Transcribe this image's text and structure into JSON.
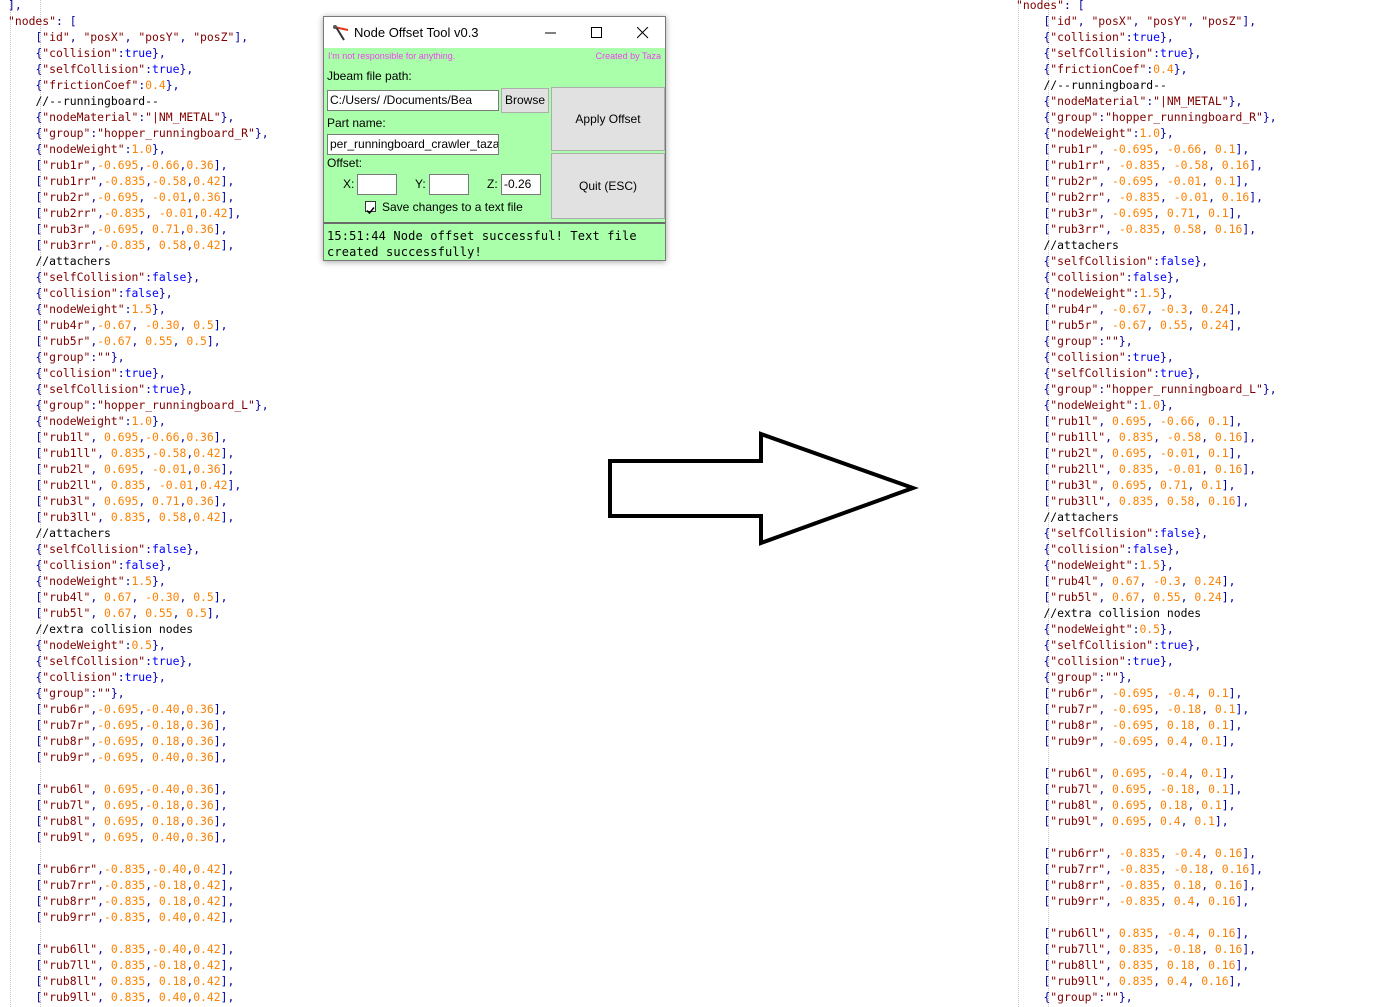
{
  "tool_window": {
    "title": "Node Offset Tool v0.3",
    "disclaimer": "I'm not responsible for anything.",
    "credit": "Created by Taza",
    "jbeam_path_label": "Jbeam file path:",
    "jbeam_path_value": "C:/Users/        /Documents/Bea",
    "browse_label": "Browse",
    "part_name_label": "Part name:",
    "part_name_value": "per_runningboard_crawler_taza",
    "offset_label": "Offset:",
    "x_label": "X:",
    "x_value": "",
    "y_label": "Y:",
    "y_value": "",
    "z_label": "Z:",
    "z_value": "-0.26",
    "save_checkbox_checked": true,
    "save_checkbox_label": "Save changes to a text file",
    "apply_label": "Apply Offset",
    "quit_label": "Quit (ESC)",
    "status_text": "15:51:44 Node offset successful! Text file\ncreated successfully!",
    "background_color": "#aaffaa"
  },
  "left_code": [
    "],",
    "\"nodes\": [",
    "    [\"id\", \"posX\", \"posY\", \"posZ\"],",
    "    {\"collision\":true},",
    "    {\"selfCollision\":true},",
    "    {\"frictionCoef\":0.4},",
    "    //--runningboard--",
    "    {\"nodeMaterial\":\"|NM_METAL\"},",
    "    {\"group\":\"hopper_runningboard_R\"},",
    "    {\"nodeWeight\":1.0},",
    "    [\"rub1r\",-0.695,-0.66,0.36],",
    "    [\"rub1rr\",-0.835,-0.58,0.42],",
    "    [\"rub2r\",-0.695, -0.01,0.36],",
    "    [\"rub2rr\",-0.835, -0.01,0.42],",
    "    [\"rub3r\",-0.695, 0.71,0.36],",
    "    [\"rub3rr\",-0.835, 0.58,0.42],",
    "    //attachers",
    "    {\"selfCollision\":false},",
    "    {\"collision\":false},",
    "    {\"nodeWeight\":1.5},",
    "    [\"rub4r\",-0.67, -0.30, 0.5],",
    "    [\"rub5r\",-0.67, 0.55, 0.5],",
    "    {\"group\":\"\"},",
    "    {\"collision\":true},",
    "    {\"selfCollision\":true},",
    "    {\"group\":\"hopper_runningboard_L\"},",
    "    {\"nodeWeight\":1.0},",
    "    [\"rub1l\", 0.695,-0.66,0.36],",
    "    [\"rub1ll\", 0.835,-0.58,0.42],",
    "    [\"rub2l\", 0.695, -0.01,0.36],",
    "    [\"rub2ll\", 0.835, -0.01,0.42],",
    "    [\"rub3l\", 0.695, 0.71,0.36],",
    "    [\"rub3ll\", 0.835, 0.58,0.42],",
    "    //attachers",
    "    {\"selfCollision\":false},",
    "    {\"collision\":false},",
    "    {\"nodeWeight\":1.5},",
    "    [\"rub4l\", 0.67, -0.30, 0.5],",
    "    [\"rub5l\", 0.67, 0.55, 0.5],",
    "    //extra collision nodes",
    "    {\"nodeWeight\":0.5},",
    "    {\"selfCollision\":true},",
    "    {\"collision\":true},",
    "    {\"group\":\"\"},",
    "    [\"rub6r\",-0.695,-0.40,0.36],",
    "    [\"rub7r\",-0.695,-0.18,0.36],",
    "    [\"rub8r\",-0.695, 0.18,0.36],",
    "    [\"rub9r\",-0.695, 0.40,0.36],",
    "",
    "    [\"rub6l\", 0.695,-0.40,0.36],",
    "    [\"rub7l\", 0.695,-0.18,0.36],",
    "    [\"rub8l\", 0.695, 0.18,0.36],",
    "    [\"rub9l\", 0.695, 0.40,0.36],",
    "",
    "    [\"rub6rr\",-0.835,-0.40,0.42],",
    "    [\"rub7rr\",-0.835,-0.18,0.42],",
    "    [\"rub8rr\",-0.835, 0.18,0.42],",
    "    [\"rub9rr\",-0.835, 0.40,0.42],",
    "",
    "    [\"rub6ll\", 0.835,-0.40,0.42],",
    "    [\"rub7ll\", 0.835,-0.18,0.42],",
    "    [\"rub8ll\", 0.835, 0.18,0.42],",
    "    [\"rub9ll\", 0.835, 0.40,0.42],"
  ],
  "right_code": [
    "\"nodes\": [",
    "    [\"id\", \"posX\", \"posY\", \"posZ\"],",
    "    {\"collision\":true},",
    "    {\"selfCollision\":true},",
    "    {\"frictionCoef\":0.4},",
    "    //--runningboard--",
    "    {\"nodeMaterial\":\"|NM_METAL\"},",
    "    {\"group\":\"hopper_runningboard_R\"},",
    "    {\"nodeWeight\":1.0},",
    "    [\"rub1r\", -0.695, -0.66, 0.1],",
    "    [\"rub1rr\", -0.835, -0.58, 0.16],",
    "    [\"rub2r\", -0.695, -0.01, 0.1],",
    "    [\"rub2rr\", -0.835, -0.01, 0.16],",
    "    [\"rub3r\", -0.695, 0.71, 0.1],",
    "    [\"rub3rr\", -0.835, 0.58, 0.16],",
    "    //attachers",
    "    {\"selfCollision\":false},",
    "    {\"collision\":false},",
    "    {\"nodeWeight\":1.5},",
    "    [\"rub4r\", -0.67, -0.3, 0.24],",
    "    [\"rub5r\", -0.67, 0.55, 0.24],",
    "    {\"group\":\"\"},",
    "    {\"collision\":true},",
    "    {\"selfCollision\":true},",
    "    {\"group\":\"hopper_runningboard_L\"},",
    "    {\"nodeWeight\":1.0},",
    "    [\"rub1l\", 0.695, -0.66, 0.1],",
    "    [\"rub1ll\", 0.835, -0.58, 0.16],",
    "    [\"rub2l\", 0.695, -0.01, 0.1],",
    "    [\"rub2ll\", 0.835, -0.01, 0.16],",
    "    [\"rub3l\", 0.695, 0.71, 0.1],",
    "    [\"rub3ll\", 0.835, 0.58, 0.16],",
    "    //attachers",
    "    {\"selfCollision\":false},",
    "    {\"collision\":false},",
    "    {\"nodeWeight\":1.5},",
    "    [\"rub4l\", 0.67, -0.3, 0.24],",
    "    [\"rub5l\", 0.67, 0.55, 0.24],",
    "    //extra collision nodes",
    "    {\"nodeWeight\":0.5},",
    "    {\"selfCollision\":true},",
    "    {\"collision\":true},",
    "    {\"group\":\"\"},",
    "    [\"rub6r\", -0.695, -0.4, 0.1],",
    "    [\"rub7r\", -0.695, -0.18, 0.1],",
    "    [\"rub8r\", -0.695, 0.18, 0.1],",
    "    [\"rub9r\", -0.695, 0.4, 0.1],",
    "",
    "    [\"rub6l\", 0.695, -0.4, 0.1],",
    "    [\"rub7l\", 0.695, -0.18, 0.1],",
    "    [\"rub8l\", 0.695, 0.18, 0.1],",
    "    [\"rub9l\", 0.695, 0.4, 0.1],",
    "",
    "    [\"rub6rr\", -0.835, -0.4, 0.16],",
    "    [\"rub7rr\", -0.835, -0.18, 0.16],",
    "    [\"rub8rr\", -0.835, 0.18, 0.16],",
    "    [\"rub9rr\", -0.835, 0.4, 0.16],",
    "",
    "    [\"rub6ll\", 0.835, -0.4, 0.16],",
    "    [\"rub7ll\", 0.835, -0.18, 0.16],",
    "    [\"rub8ll\", 0.835, 0.18, 0.16],",
    "    [\"rub9ll\", 0.835, 0.4, 0.16],",
    "    {\"group\":\"\"},"
  ],
  "colors": {
    "string": "#800000",
    "number": "#ff8000",
    "keyword": "#0000ff",
    "punctuation": "#0000a0",
    "status_border": "#6a6a6a"
  },
  "icons": {
    "app": "drafting-compass-icon",
    "minimize": "minimize-icon",
    "maximize": "maximize-icon",
    "close": "close-icon",
    "checkbox": "checkmark-icon",
    "arrow": "right-arrow-icon"
  }
}
